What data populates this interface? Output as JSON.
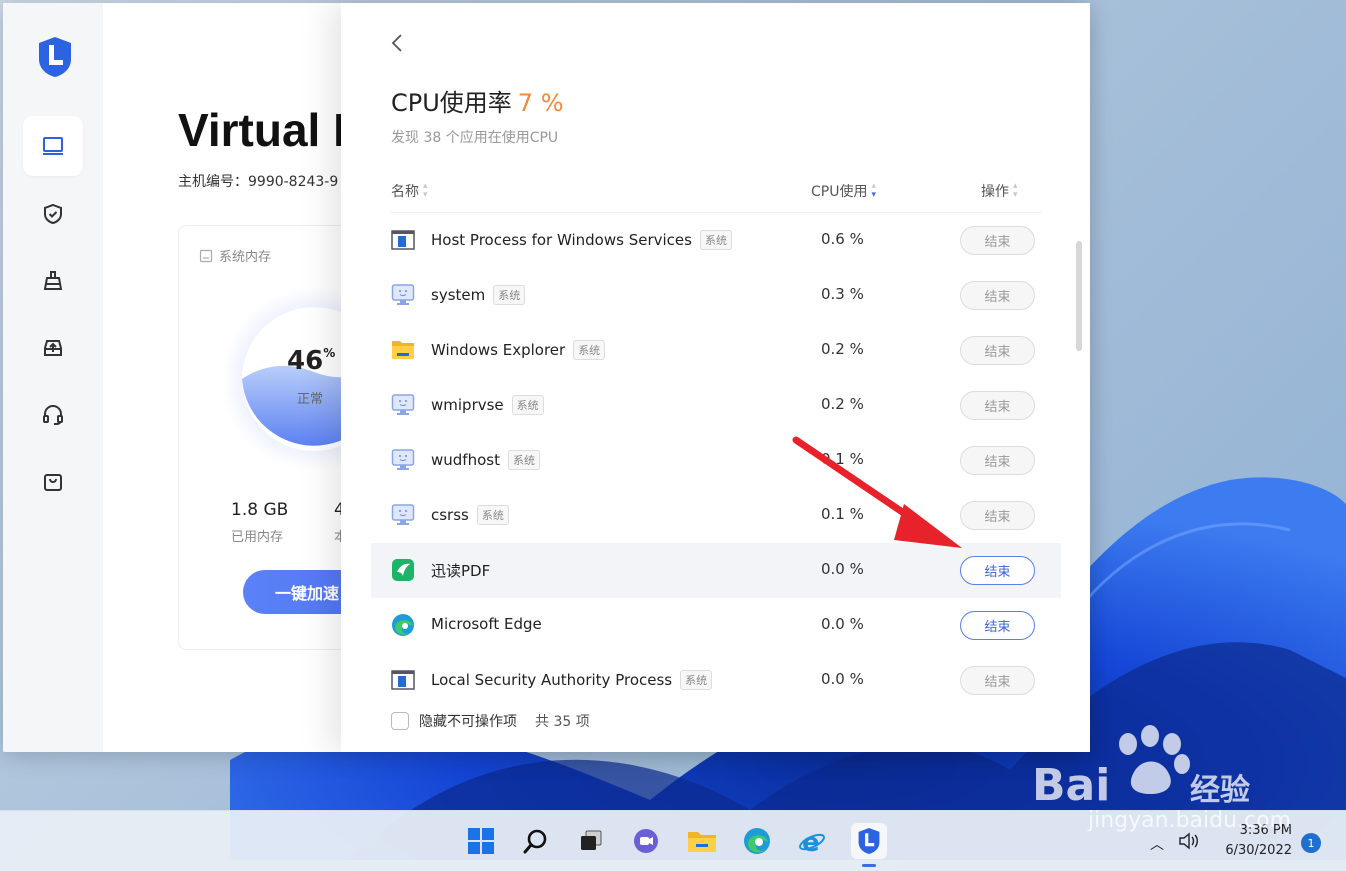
{
  "app": {
    "dashboard_title": "Virtual I",
    "host_id": "主机编号：9990-8243-9",
    "memory_card": {
      "title": "系统内存",
      "percent": "46",
      "percent_unit": "%",
      "status": "正常",
      "used_value": "1.8 GB",
      "used_label": "已用内存",
      "total_value": "4",
      "total_label": "本",
      "boost_button": "一键加速"
    },
    "sidebar_items": [
      "computer-icon",
      "shield-check-icon",
      "cleaner-icon",
      "upload-tray-icon",
      "headset-icon",
      "shopping-bag-icon"
    ]
  },
  "cpu_panel": {
    "title": "CPU使用率",
    "percent": "7 %",
    "subtitle": "发现 38 个应用在使用CPU",
    "columns": {
      "name": "名称",
      "cpu": "CPU使用",
      "action": "操作"
    },
    "rows": [
      {
        "name": "Host Process for Windows Services",
        "badge": "系统",
        "cpu": "0.6 %",
        "action": "结束",
        "icon": "window-icon",
        "enabled": false
      },
      {
        "name": "system",
        "badge": "系统",
        "cpu": "0.3 %",
        "action": "结束",
        "icon": "monitor-face-icon",
        "enabled": false
      },
      {
        "name": "Windows Explorer",
        "badge": "系统",
        "cpu": "0.2 %",
        "action": "结束",
        "icon": "folder-icon",
        "enabled": false
      },
      {
        "name": "wmiprvse",
        "badge": "系统",
        "cpu": "0.2 %",
        "action": "结束",
        "icon": "monitor-face-icon",
        "enabled": false
      },
      {
        "name": "wudfhost",
        "badge": "系统",
        "cpu": "0.1 %",
        "action": "结束",
        "icon": "monitor-face-icon",
        "enabled": false
      },
      {
        "name": "csrss",
        "badge": "系统",
        "cpu": "0.1 %",
        "action": "结束",
        "icon": "monitor-face-icon",
        "enabled": false
      },
      {
        "name": "迅读PDF",
        "badge": "",
        "cpu": "0.0 %",
        "action": "结束",
        "icon": "xundu-pdf-icon",
        "enabled": true
      },
      {
        "name": "Microsoft Edge",
        "badge": "",
        "cpu": "0.0 %",
        "action": "结束",
        "icon": "edge-icon",
        "enabled": true
      },
      {
        "name": "Local Security Authority Process",
        "badge": "系统",
        "cpu": "0.0 %",
        "action": "结束",
        "icon": "window-icon",
        "enabled": false
      }
    ],
    "footer": {
      "checkbox_label": "隐藏不可操作项",
      "count": "共 35 项"
    }
  },
  "taskbar": {
    "icons": [
      "windows-start-icon",
      "search-icon",
      "task-view-icon",
      "teams-chat-icon",
      "file-explorer-icon",
      "edge-icon",
      "ie-icon",
      "lenovo-pc-manager-icon"
    ],
    "time": "3:36 PM",
    "date": "6/30/2022",
    "notifications": "1"
  },
  "watermark": {
    "brand": "Baidu经验",
    "url": "jingyan.baidu.com"
  },
  "colors": {
    "accent": "#4e6ef0",
    "cpu_percent": "#f6883a",
    "annotation": "#e8222a"
  }
}
